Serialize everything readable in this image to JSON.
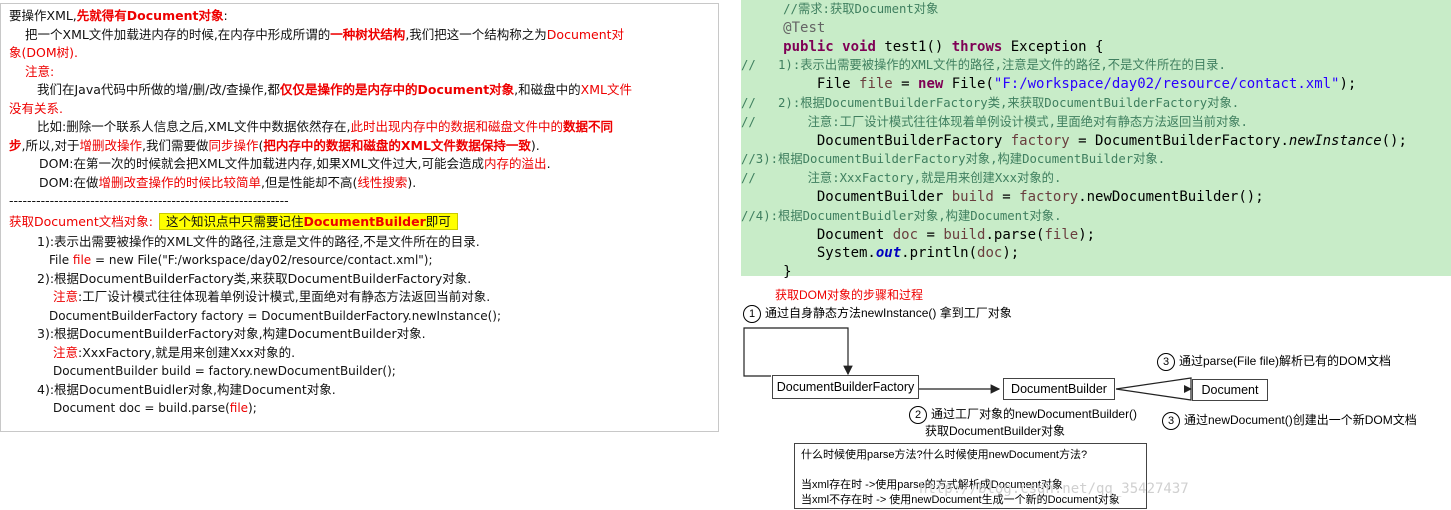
{
  "notes": {
    "l1a": "要操作XML,",
    "l1b": "先就得有Document对象",
    ":": ":",
    "l2a": "把一个XML文件加载进内存的时候,在内存中形成所谓的",
    "l2b": "一种树状结构",
    "l2c": ",我们把这一个结构称之为",
    "l2d": "Document对",
    "l3": "象(DOM树).",
    "l4": "注意:",
    "l5a": "我们在Java代码中所做的增/删/改/查操作,都",
    "l5b": "仅仅是操作的是内存中的Document对象",
    "l5c": ",和磁盘中的",
    "l5d": "XML文件",
    "l6": "没有关系.",
    "l7a": "比如:删除一个联系人信息之后,XML文件中数据依然存在,",
    "l7b": "此时出现内存中的数据和磁盘文件中的",
    "l7c": "数据不同",
    "l8a": "步",
    "l8b": ",所以,对于",
    "l8c": "增删改操作",
    "l8d": ",我们需要做",
    "l8e": "同步操作",
    "l8f": "(",
    "l8g": "把内存中的数据和磁盘的XML文件数据保持一致",
    "l8h": ").",
    "l9a": "DOM:在第一次的时候就会把XML文件加载进内存,如果XML文件过大,可能会造成",
    "l9b": "内存的溢出",
    "l9c": ".",
    "l10a": "DOM:在做",
    "l10b": "增删改查操作的时候比较简单",
    "l10c": ",但是性能却不高(",
    "l10d": "线性搜索",
    "l10e": ").",
    "sep": "--------------------------------------------------------------",
    "get_title": "获取Document文档对象:",
    "hl_a": "这个知识点中只需要记住",
    "hl_b": "DocumentBuilder",
    "hl_c": "即可",
    "s1": "1):表示出需要被操作的XML文件的路径,注意是文件的路径,不是文件所在的目录.",
    "s1c_a": "File ",
    "s1c_b": "file",
    " s1c_c": "",
    "s1c_c": " = new File(\"F:/workspace/day02/resource/contact.xml\");",
    "s2": "2):根据DocumentBuilderFactory类,来获取DocumentBuilderFactory对象.",
    "s2n_a": "注意",
    "s2n_b": ":工厂设计模式往往体现着单例设计模式,里面绝对有静态方法返回当前对象.",
    "s2c": "DocumentBuilderFactory factory = DocumentBuilderFactory.newInstance();",
    "s3": "3):根据DocumentBuilderFactory对象,构建DocumentBuilder对象.",
    "s3n_a": "注意",
    "s3n_b": ":XxxFactory,就是用来创建Xxx对象的.",
    "s3c": "DocumentBuilder build = factory.newDocumentBuilder();",
    "s4": "4):根据DocumentBuidler对象,构建Document对象.",
    "s4c_a": "Document doc = build.parse(",
    "s4c_b": "file",
    "s4c_c": ");"
  },
  "code": {
    "c1": "//需求:获取Document对象",
    "ann": "@Test",
    "kw_public": "public",
    "kw_void": "void",
    "m_rest": " test1() ",
    "kw_throws": "throws",
    "m_end": " Exception {",
    "c2": "//   1):表示出需要被操作的XML文件的路径,注意是文件的路径,不是文件所在的目录.",
    "l_file_a": "File ",
    "l_file_v": "file",
    "l_file_b": " = ",
    "kw_new": "new",
    "l_file_c": " File(",
    "l_file_s": "\"F:/workspace/day02/resource/contact.xml\"",
    "l_file_d": ");",
    "c3": "//   2):根据DocumentBuilderFactory类,来获取DocumentBuilderFactory对象.",
    "c4": "//       注意:工厂设计模式往往体现着单例设计模式,里面绝对有静态方法返回当前对象.",
    "l_fac_a": "DocumentBuilderFactory ",
    "l_fac_v": "factory",
    "l_fac_b": " = DocumentBuilderFactory.",
    "l_fac_m": "newInstance",
    "l_fac_c": "();",
    "c5": "//3):根据DocumentBuilderFactory对象,构建DocumentBuilder对象.",
    "c6": "//       注意:XxxFactory,就是用来创建Xxx对象的.",
    "l_b_a": "DocumentBuilder ",
    "l_b_v": "build",
    "l_b_b": " = ",
    "l_b_v2": "factory",
    "l_b_c": ".newDocumentBuilder();",
    "c7": "//4):根据DocumentBuidler对象,构建Document对象.",
    "l_d_a": "Document ",
    "l_d_v": "doc",
    "l_d_b": " = ",
    "l_d_v2": "build",
    "l_d_c": ".parse(",
    "l_d_v3": "file",
    "l_d_e": ");",
    "l_p_a": "System.",
    "l_p_f": "out",
    "l_p_b": ".println(",
    "l_p_v": "doc",
    "l_p_c": ");",
    "close": "}"
  },
  "diagram": {
    "title": "获取DOM对象的步骤和过程",
    "n1": "1",
    "t1": "通过自身静态方法newInstance() 拿到工厂对象",
    "n2": "2",
    "t2a": "通过工厂对象的newDocumentBuilder()",
    "t2b": "获取DocumentBuilder对象",
    "n3a": "3",
    "t3a": "通过parse(File file)解析已有的DOM文档",
    "n3b": "3",
    "t3b": "通过newDocument()创建出一个新DOM文档",
    "box_factory": "DocumentBuilderFactory",
    "box_builder": "DocumentBuilder",
    "box_document": "Document",
    "q": "什么时候使用parse方法?什么时候使用newDocument方法?",
    "a1": "当xml存在时 ->使用parse的方式解析成Document对象",
    "a2": "当xml不存在时 -> 使用newDocument生成一个新的Document对象"
  },
  "watermark": "http://blog.csdn.net/qq_35427437"
}
